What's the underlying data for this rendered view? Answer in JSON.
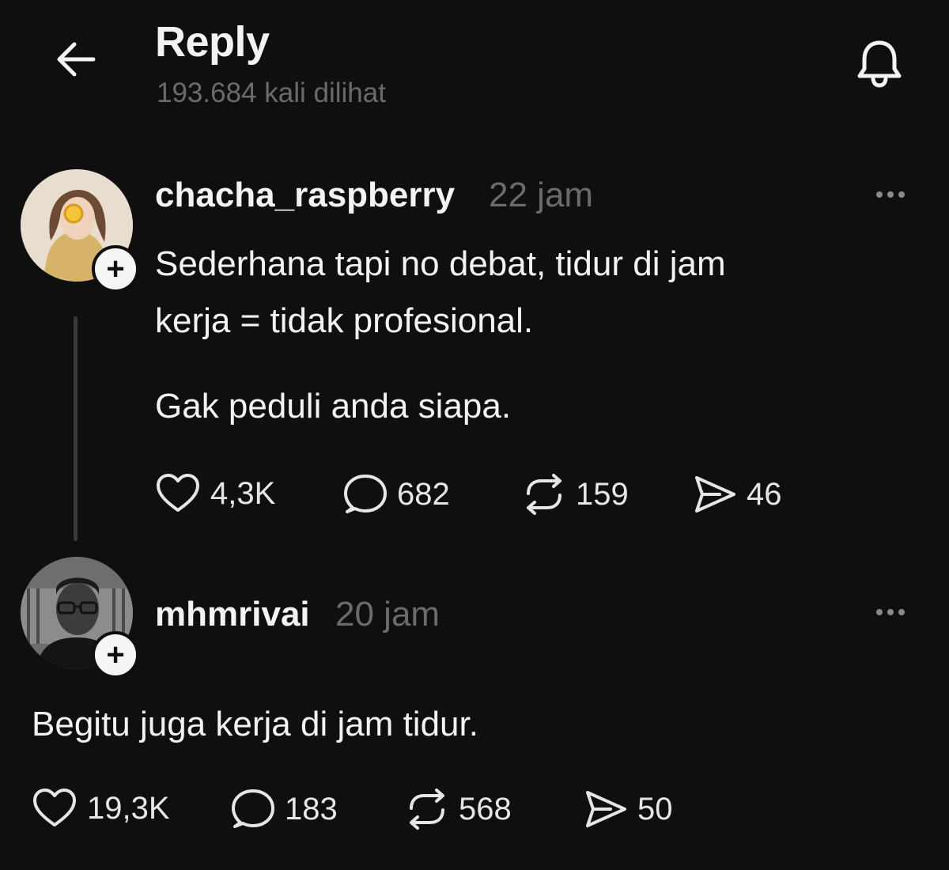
{
  "header": {
    "title": "Reply",
    "views": "193.684 kali dilihat"
  },
  "posts": [
    {
      "username": "chacha_raspberry",
      "time": "22 jam",
      "lines": [
        "Sederhana tapi no debat, tidur di jam",
        "kerja = tidak profesional.",
        "Gak peduli anda siapa."
      ],
      "likes": "4,3K",
      "replies": "682",
      "reposts": "159",
      "shares": "46"
    },
    {
      "username": "mhmrivai",
      "time": "20 jam",
      "lines": [
        "Begitu juga kerja di jam tidur."
      ],
      "likes": "19,3K",
      "replies": "183",
      "reposts": "568",
      "shares": "50"
    }
  ],
  "follow_glyph": "+",
  "colors": {
    "background": "#0f0f0f",
    "text": "#f3f3f3",
    "muted": "#6b6b6b"
  },
  "icons": [
    "back-arrow-icon",
    "bell-icon",
    "more-icon",
    "heart-icon",
    "comment-icon",
    "repost-icon",
    "share-icon"
  ]
}
